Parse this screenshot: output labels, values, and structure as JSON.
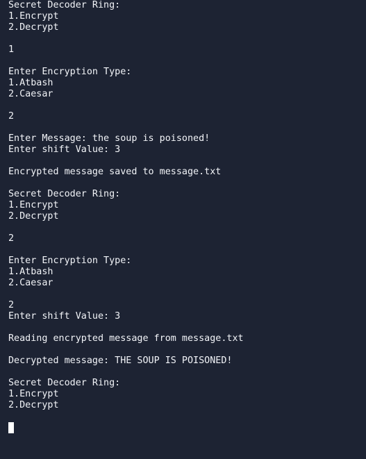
{
  "terminal": {
    "lines": [
      "Secret Decoder Ring:",
      "1.Encrypt",
      "2.Decrypt",
      "",
      "1",
      "",
      "Enter Encryption Type:",
      "1.Atbash",
      "2.Caesar",
      "",
      "2",
      "",
      "Enter Message: the soup is poisoned!",
      "Enter shift Value: 3",
      "",
      "Encrypted message saved to message.txt",
      "",
      "Secret Decoder Ring:",
      "1.Encrypt",
      "2.Decrypt",
      "",
      "2",
      "",
      "Enter Encryption Type:",
      "1.Atbash",
      "2.Caesar",
      "",
      "2",
      "Enter shift Value: 3",
      "",
      "Reading encrypted message from message.txt",
      "",
      "Decrypted message: THE SOUP IS POISONED!",
      "",
      "Secret Decoder Ring:",
      "1.Encrypt",
      "2.Decrypt",
      ""
    ]
  },
  "colors": {
    "background": "#1d2333",
    "text": "#f2f4f8",
    "cursor": "#ffffff"
  }
}
